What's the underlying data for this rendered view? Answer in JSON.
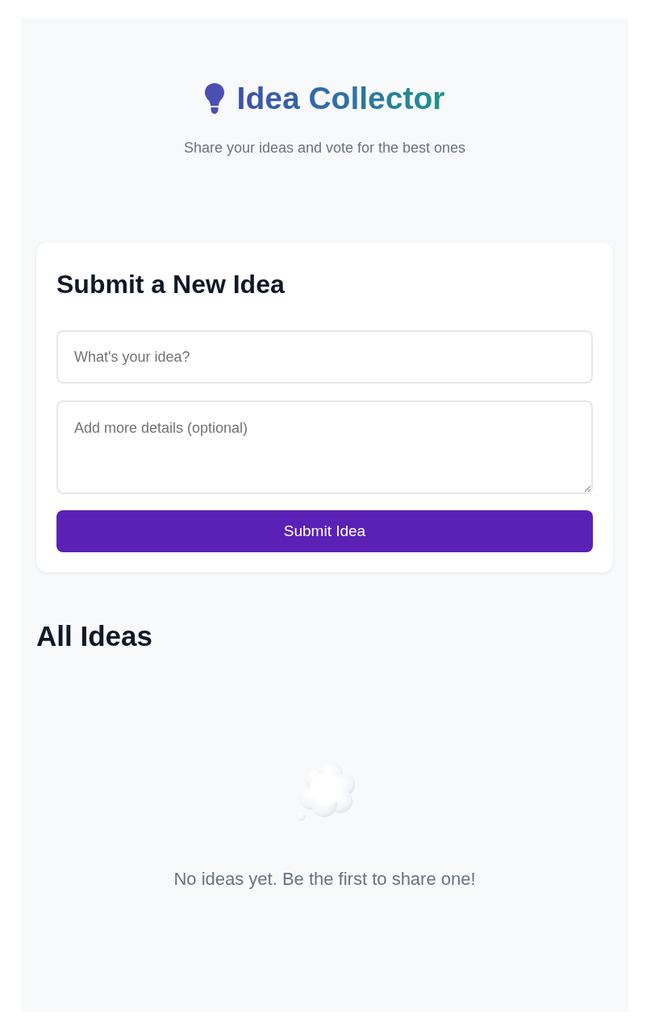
{
  "header": {
    "title": "Idea Collector",
    "subtitle": "Share your ideas and vote for the best ones"
  },
  "form": {
    "heading": "Submit a New Idea",
    "title_field": {
      "placeholder": "What's your idea?"
    },
    "details_field": {
      "placeholder": "Add more details (optional)"
    },
    "submit_button": "Submit Idea"
  },
  "ideas": {
    "heading": "All Ideas",
    "empty_message": "No ideas yet. Be the first to share one!"
  }
}
